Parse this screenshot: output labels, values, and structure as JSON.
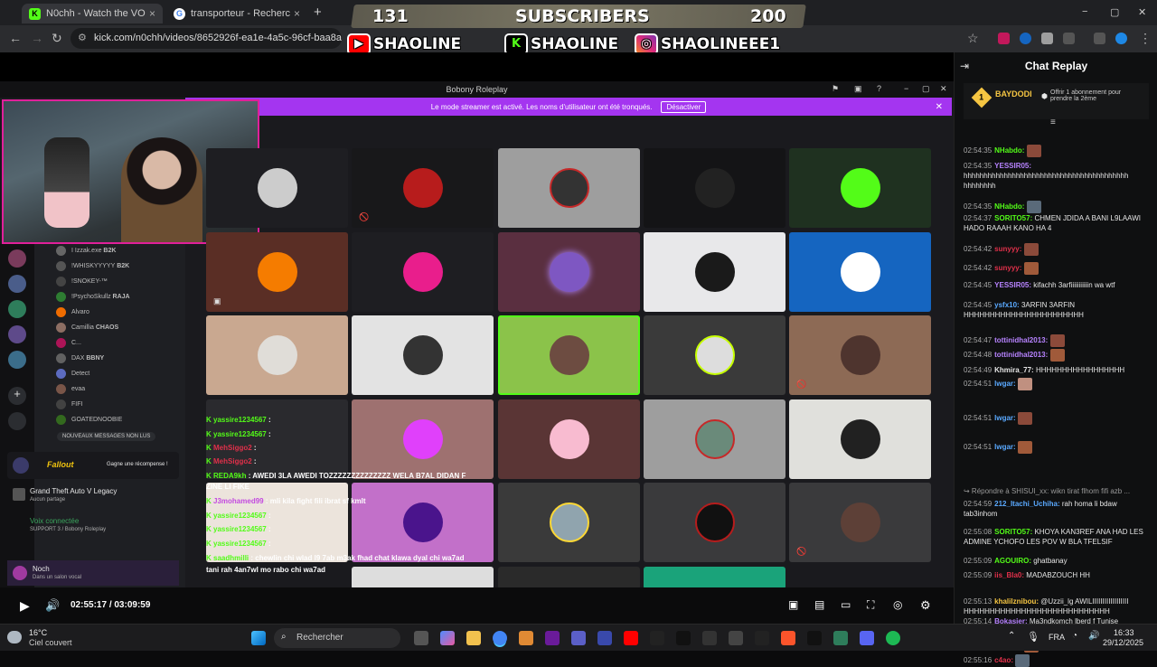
{
  "browser": {
    "tabs": [
      {
        "title": "N0chh - Watch the VOD on Kick",
        "close": "×"
      },
      {
        "title": "transporteur - Recherche Google",
        "close": "×"
      }
    ],
    "new_tab": "+",
    "url": "kick.com/n0chh/videos/8652926f-ea1e-4a5c-96cf-baa8a57d9cd1",
    "window_controls": {
      "min": "−",
      "max": "▢",
      "close": "✕"
    }
  },
  "banner": {
    "count_left": "131",
    "label": "SUBSCRIBERS",
    "count_right": "200",
    "socials": [
      "SHAOLINE",
      "SHAOLINE",
      "SHAOLINEEE1"
    ]
  },
  "discord": {
    "window_title": "Bobony Roleplay",
    "streamer_notice": "Le mode streamer est activé. Les noms d'utilisateur ont été tronqués.",
    "disable_label": "Désactiver",
    "members": [
      {
        "name": "I Izzak.exe",
        "tag": "B2K"
      },
      {
        "name": "!WHISKYYYYY",
        "tag": "B2K"
      },
      {
        "name": "!SNOKEY-™",
        "tag": ""
      },
      {
        "name": "!PsychoSkullz",
        "tag": "RAJA"
      },
      {
        "name": "Alvaro",
        "tag": ""
      },
      {
        "name": "Camillia",
        "tag": "CHAOS"
      },
      {
        "name": "C...",
        "tag": ""
      },
      {
        "name": "DAX",
        "tag": "BBNY"
      },
      {
        "name": "Detect",
        "tag": ""
      },
      {
        "name": "evaa",
        "tag": ""
      },
      {
        "name": "FIFI",
        "tag": ""
      },
      {
        "name": "GOATEDNOOBIE",
        "tag": ""
      }
    ],
    "new_messages": "NOUVEAUX MESSAGES NON LUS",
    "promo": {
      "brand": "Fallout",
      "cta": "Gagne une récompense !"
    },
    "activity": {
      "game": "Grand Theft Auto V Legacy",
      "sub": "Aucun partage"
    },
    "voice": {
      "status": "Voix connectée",
      "channel": "SUPPORT 3 / Bobony Roleplay"
    },
    "user": {
      "name": "Noch",
      "status": "Dans un salon vocal"
    },
    "overlay_chat": [
      {
        "user": "yassire1234567",
        "msg": ":",
        "color": "#53fc18"
      },
      {
        "user": "yassire1234567",
        "msg": ":",
        "color": "#53fc18"
      },
      {
        "user": "MehSiggo2",
        "msg": ":",
        "color": "#e0304a"
      },
      {
        "user": "MehSiggo2",
        "msg": ":",
        "color": "#e0304a"
      },
      {
        "user": "REDA9kh",
        "msg": ": AWEDI 3LA AWEDI TOZZZZZZZZZZZZZZ WELA B7AL DIDAN F",
        "color": "#53fc18"
      },
      {
        "user": "",
        "msg": "ZINE LI FIKE",
        "color": "#fff"
      },
      {
        "user": "J3mohamed99",
        "msg": ": mli kila fight fili ibrat sf kmlt",
        "color": "#c34ae0"
      },
      {
        "user": "yassire1234567",
        "msg": ":",
        "color": "#53fc18"
      },
      {
        "user": "yassire1234567",
        "msg": ":",
        "color": "#53fc18"
      },
      {
        "user": "yassire1234567",
        "msg": ":",
        "color": "#53fc18"
      },
      {
        "user": "saadhmilli",
        "msg": ": chewlin chi wlad l9 7ab m3ak fhad chat klawa dyal chi wa7ad",
        "color": "#53fc18"
      },
      {
        "user": "",
        "msg": "tani rah 4an7wl mo rabo chi wa7ad",
        "color": "#fff"
      }
    ]
  },
  "player": {
    "current": "02:55:17",
    "separator": "/",
    "duration": "03:09:59",
    "progress": 0.924
  },
  "chat": {
    "title": "Chat Replay",
    "pinned": {
      "user": "BAYDODI",
      "count": "1",
      "text": "Offrir 1 abonnement pour prendre la 2ème"
    },
    "messages": [
      {
        "t": "02:54:35",
        "u": "NHabdo:",
        "c": "#53fc18",
        "m": ""
      },
      {
        "t": "02:54:35",
        "u": "YESSIR05:",
        "c": "#b783ff",
        "m": "hhhhhhhhhhhhhhhhhhhhhhhhhhhhhhhhhhhhhhhhh hhhhhhhh"
      },
      {
        "t": "02:54:35",
        "u": "NHabdo:",
        "c": "#53fc18",
        "m": ""
      },
      {
        "t": "02:54:37",
        "u": "SORITO57:",
        "c": "#53fc18",
        "m": "CHMEN JDIDA A BANI L9LAAWI HADO RAAAH KANO HA 4"
      },
      {
        "t": "02:54:42",
        "u": "sunyyy:",
        "c": "#e0304a",
        "m": ""
      },
      {
        "t": "02:54:42",
        "u": "sunyyy:",
        "c": "#e0304a",
        "m": ""
      },
      {
        "t": "02:54:45",
        "u": "YESSIR05:",
        "c": "#b783ff",
        "m": "kifachh 3arfiiiiiiiiiiin wa wtf"
      },
      {
        "t": "02:54:45",
        "u": "ysfx10:",
        "c": "#5aa9ff",
        "m": "3ARFIN 3ARFIN HHHHHHHHHHHHHHHHHHHHHHH"
      },
      {
        "t": "02:54:47",
        "u": "tottinidhal2013:",
        "c": "#b783ff",
        "m": ""
      },
      {
        "t": "02:54:48",
        "u": "tottinidhal2013:",
        "c": "#b783ff",
        "m": ""
      },
      {
        "t": "02:54:49",
        "u": "Khmira_77:",
        "c": "#e6e6e6",
        "m": "HHHHHHHHHHHHHHHHH"
      },
      {
        "t": "02:54:51",
        "u": "lwgar:",
        "c": "#5aa9ff",
        "m": ""
      },
      {
        "t": "02:54:51",
        "u": "lwgar:",
        "c": "#5aa9ff",
        "m": ""
      },
      {
        "t": "02:54:51",
        "u": "lwgar:",
        "c": "#5aa9ff",
        "m": ""
      },
      {
        "t": "",
        "u": "",
        "c": "#999",
        "m": "↪ Répondre à SHISUI_xx: wikn tirat flhom fifi azb ..."
      },
      {
        "t": "02:54:59",
        "u": "212_Itachi_Uchiha:",
        "c": "#5aa9ff",
        "m": "rah homa li bdaw tab3inhom"
      },
      {
        "t": "02:55:08",
        "u": "SORITO57:",
        "c": "#53fc18",
        "m": "KHOYA KAN3REF ANA HAD LES ADMINE YCHOFO LES POV W BLA TFELSIF"
      },
      {
        "t": "02:55:09",
        "u": "AGOUIRO:",
        "c": "#53fc18",
        "m": "ghatbanay"
      },
      {
        "t": "02:55:09",
        "u": "iis_Bla0:",
        "c": "#e0304a",
        "m": "MADABZOUCH HH"
      },
      {
        "t": "02:55:13",
        "u": "khalilznibou:",
        "c": "#f5c542",
        "m": "@Uzzii_lg AWILIIIIIIIIIIIIIIIIII HHHHHHHHHHHHHHHHHHHHHHHHHHHH"
      },
      {
        "t": "02:55:14",
        "u": "Bokasier:",
        "c": "#b783ff",
        "m": "Ma3ndkomch lberd f Tunise"
      },
      {
        "t": "02:55:14",
        "u": "sunyyy:",
        "c": "#e0304a",
        "m": ""
      },
      {
        "t": "02:55:16",
        "u": "c4ao:",
        "c": "#e0304a",
        "m": ""
      }
    ]
  },
  "taskbar": {
    "weather_temp": "16°C",
    "weather_desc": "Ciel couvert",
    "search": "Rechercher",
    "lang": "FRA",
    "time": "16:33",
    "date": "29/12/2025"
  }
}
